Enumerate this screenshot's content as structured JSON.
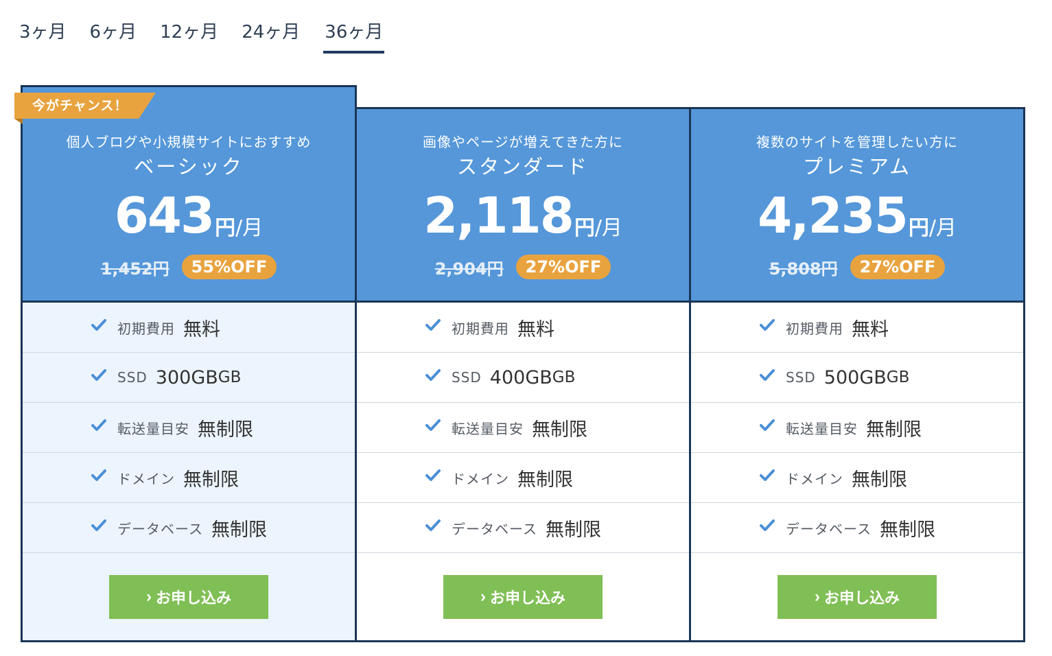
{
  "tabs": [
    {
      "label": "3ヶ月"
    },
    {
      "label": "6ヶ月"
    },
    {
      "label": "12ヶ月"
    },
    {
      "label": "24ヶ月"
    },
    {
      "label": "36ヶ月",
      "active": true
    }
  ],
  "plans": [
    {
      "ribbon": "今がチャンス！",
      "subtitle": "個人ブログや小規模サイトにおすすめ",
      "name": "ベーシック",
      "price": "643",
      "yen": "円",
      "per": "/月",
      "original_price": "1,452円",
      "discount": "55%OFF",
      "features": [
        {
          "label": "初期費用",
          "value": "無料",
          "unit": ""
        },
        {
          "label": "SSD",
          "value": "300GB",
          "unit": "GB"
        },
        {
          "label": "転送量目安",
          "value": "無制限",
          "unit": ""
        },
        {
          "label": "ドメイン",
          "value": "無制限",
          "unit": ""
        },
        {
          "label": "データベース",
          "value": "無制限",
          "unit": ""
        }
      ],
      "button": "お申し込み"
    },
    {
      "subtitle": "画像やページが増えてきた方に",
      "name": "スタンダード",
      "price": "2,118",
      "yen": "円",
      "per": "/月",
      "original_price": "2,904円",
      "discount": "27%OFF",
      "features": [
        {
          "label": "初期費用",
          "value": "無料",
          "unit": ""
        },
        {
          "label": "SSD",
          "value": "400GB",
          "unit": "GB"
        },
        {
          "label": "転送量目安",
          "value": "無制限",
          "unit": ""
        },
        {
          "label": "ドメイン",
          "value": "無制限",
          "unit": ""
        },
        {
          "label": "データベース",
          "value": "無制限",
          "unit": ""
        }
      ],
      "button": "お申し込み"
    },
    {
      "subtitle": "複数のサイトを管理したい方に",
      "name": "プレミアム",
      "price": "4,235",
      "yen": "円",
      "per": "/月",
      "original_price": "5,808円",
      "discount": "27%OFF",
      "features": [
        {
          "label": "初期費用",
          "value": "無料",
          "unit": ""
        },
        {
          "label": "SSD",
          "value": "500GB",
          "unit": "GB"
        },
        {
          "label": "転送量目安",
          "value": "無制限",
          "unit": ""
        },
        {
          "label": "ドメイン",
          "value": "無制限",
          "unit": ""
        },
        {
          "label": "データベース",
          "value": "無制限",
          "unit": ""
        }
      ],
      "button": "お申し込み"
    }
  ],
  "icons": {
    "check": "check-icon",
    "button_chevron": "chevron-right-icon"
  },
  "colors": {
    "header_blue": "#5597d9",
    "border_navy": "#1a3556",
    "badge_orange": "#e8a33f",
    "button_green": "#80bf55",
    "highlight_bg": "#ecf4fd"
  }
}
